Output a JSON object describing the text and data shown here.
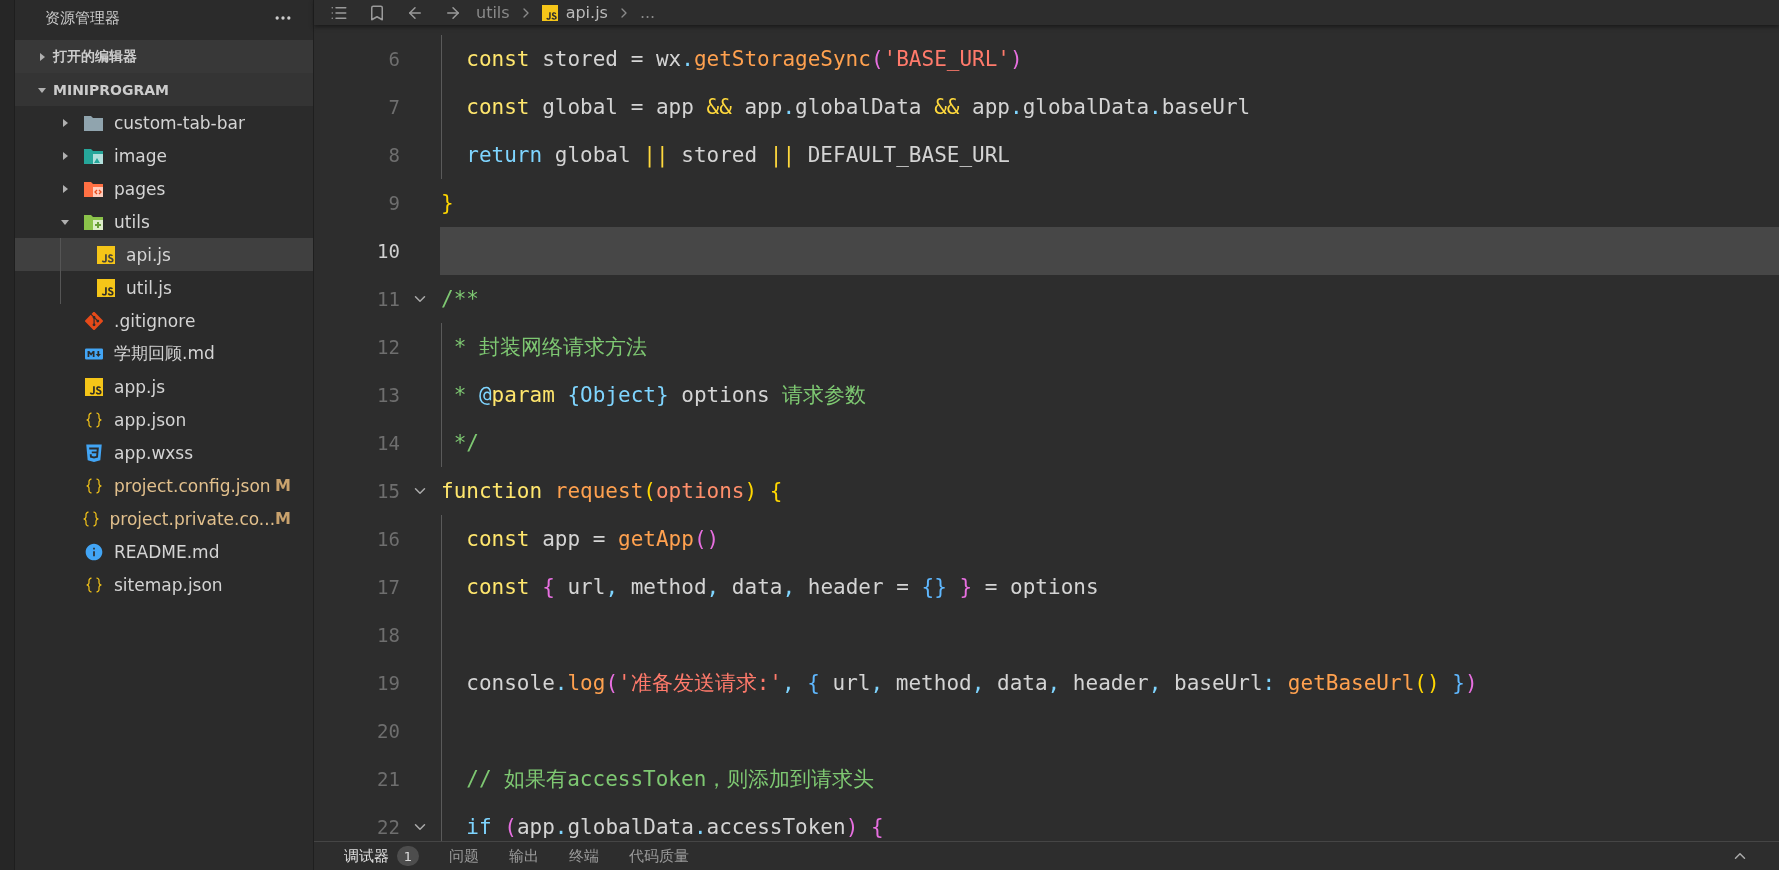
{
  "sidebar": {
    "title": "资源管理器",
    "sections": [
      {
        "label": "打开的编辑器",
        "expanded": false
      },
      {
        "label": "MINIPROGRAM",
        "expanded": true,
        "items": [
          {
            "name": "custom-tab-bar",
            "kind": "folder",
            "expanded": false,
            "selected": false
          },
          {
            "name": "image",
            "kind": "image-folder",
            "expanded": false,
            "selected": false
          },
          {
            "name": "pages",
            "kind": "pages-folder",
            "expanded": false,
            "selected": false
          },
          {
            "name": "utils",
            "kind": "utils-folder",
            "expanded": true,
            "selected": false,
            "children": [
              {
                "name": "api.js",
                "kind": "js",
                "selected": true
              },
              {
                "name": "util.js",
                "kind": "js",
                "selected": false
              }
            ]
          },
          {
            "name": ".gitignore",
            "kind": "git",
            "selected": false
          },
          {
            "name": "学期回顾.md",
            "kind": "markdown",
            "selected": false
          },
          {
            "name": "app.js",
            "kind": "js",
            "selected": false
          },
          {
            "name": "app.json",
            "kind": "json",
            "selected": false
          },
          {
            "name": "app.wxss",
            "kind": "css",
            "selected": false
          },
          {
            "name": "project.config.json",
            "kind": "json",
            "selected": false,
            "status": "M"
          },
          {
            "name": "project.private.co...",
            "kind": "json",
            "selected": false,
            "status": "M"
          },
          {
            "name": "README.md",
            "kind": "info",
            "selected": false
          },
          {
            "name": "sitemap.json",
            "kind": "json",
            "selected": false
          }
        ]
      }
    ]
  },
  "breadcrumb": [
    {
      "label": "utils",
      "kind": "folder"
    },
    {
      "label": "api.js",
      "kind": "js"
    },
    {
      "label": "...",
      "kind": "more"
    }
  ],
  "editor": {
    "lines": [
      {
        "number": "6",
        "guide": true,
        "fold": false,
        "current": false,
        "tokens": [
          {
            "kind": "kw",
            "text": "  const"
          },
          {
            "kind": "plain",
            "text": " stored = wx"
          },
          {
            "kind": "punct",
            "text": "."
          },
          {
            "kind": "fn",
            "text": "getStorageSync"
          },
          {
            "kind": "b2",
            "text": "("
          },
          {
            "kind": "str",
            "text": "'BASE_URL'"
          },
          {
            "kind": "b2",
            "text": ")"
          }
        ]
      },
      {
        "number": "7",
        "guide": true,
        "fold": false,
        "current": false,
        "tokens": [
          {
            "kind": "kw",
            "text": "  const"
          },
          {
            "kind": "plain",
            "text": " global = app "
          },
          {
            "kind": "op",
            "text": "&&"
          },
          {
            "kind": "plain",
            "text": " app"
          },
          {
            "kind": "punct",
            "text": "."
          },
          {
            "kind": "plain",
            "text": "globalData "
          },
          {
            "kind": "op",
            "text": "&&"
          },
          {
            "kind": "plain",
            "text": " app"
          },
          {
            "kind": "punct",
            "text": "."
          },
          {
            "kind": "plain",
            "text": "globalData"
          },
          {
            "kind": "punct",
            "text": "."
          },
          {
            "kind": "plain",
            "text": "baseUrl"
          }
        ]
      },
      {
        "number": "8",
        "guide": true,
        "fold": false,
        "current": false,
        "tokens": [
          {
            "kind": "kw2",
            "text": "  return"
          },
          {
            "kind": "plain",
            "text": " global "
          },
          {
            "kind": "op",
            "text": "||"
          },
          {
            "kind": "plain",
            "text": " stored "
          },
          {
            "kind": "op",
            "text": "||"
          },
          {
            "kind": "plain",
            "text": " DEFAULT_BASE_URL"
          }
        ]
      },
      {
        "number": "9",
        "guide": false,
        "fold": false,
        "current": false,
        "tokens": [
          {
            "kind": "b1",
            "text": "}"
          }
        ]
      },
      {
        "number": "10",
        "guide": false,
        "fold": false,
        "current": true
      },
      {
        "number": "11",
        "guide": false,
        "fold": true,
        "current": false,
        "tokens": [
          {
            "kind": "comment",
            "text": "/**"
          }
        ]
      },
      {
        "number": "12",
        "guide": true,
        "fold": false,
        "current": false,
        "tokens": [
          {
            "kind": "comment",
            "text": " * 封装网络请求方法"
          }
        ]
      },
      {
        "number": "13",
        "guide": true,
        "fold": false,
        "current": false,
        "tokens": [
          {
            "kind": "comment",
            "text": " * "
          },
          {
            "kind": "punct",
            "text": "@"
          },
          {
            "kind": "kw",
            "text": "param"
          },
          {
            "kind": "type",
            "text": " {Object}"
          },
          {
            "kind": "plain",
            "text": " options "
          },
          {
            "kind": "comment",
            "text": "请求参数"
          }
        ]
      },
      {
        "number": "14",
        "guide": true,
        "fold": false,
        "current": false,
        "tokens": [
          {
            "kind": "comment",
            "text": " */"
          }
        ]
      },
      {
        "number": "15",
        "guide": false,
        "fold": true,
        "current": false,
        "tokens": [
          {
            "kind": "kw",
            "text": "function"
          },
          {
            "kind": "fn",
            "text": " request"
          },
          {
            "kind": "b1",
            "text": "("
          },
          {
            "kind": "param",
            "text": "options"
          },
          {
            "kind": "b1",
            "text": ") {"
          }
        ]
      },
      {
        "number": "16",
        "guide": true,
        "fold": false,
        "current": false,
        "tokens": [
          {
            "kind": "kw",
            "text": "  const"
          },
          {
            "kind": "plain",
            "text": " app = "
          },
          {
            "kind": "fn",
            "text": "getApp"
          },
          {
            "kind": "b2",
            "text": "()"
          }
        ]
      },
      {
        "number": "17",
        "guide": true,
        "fold": false,
        "current": false,
        "tokens": [
          {
            "kind": "kw",
            "text": "  const"
          },
          {
            "kind": "b2",
            "text": " {"
          },
          {
            "kind": "plain",
            "text": " url"
          },
          {
            "kind": "punct",
            "text": ","
          },
          {
            "kind": "plain",
            "text": " method"
          },
          {
            "kind": "punct",
            "text": ","
          },
          {
            "kind": "plain",
            "text": " data"
          },
          {
            "kind": "punct",
            "text": ","
          },
          {
            "kind": "plain",
            "text": " header = "
          },
          {
            "kind": "b3",
            "text": "{}"
          },
          {
            "kind": "b2",
            "text": " }"
          },
          {
            "kind": "plain",
            "text": " = options"
          }
        ]
      },
      {
        "number": "18",
        "guide": true,
        "fold": false,
        "current": false
      },
      {
        "number": "19",
        "guide": true,
        "fold": false,
        "current": false,
        "tokens": [
          {
            "kind": "plain",
            "text": "  console"
          },
          {
            "kind": "punct",
            "text": "."
          },
          {
            "kind": "fn",
            "text": "log"
          },
          {
            "kind": "b2",
            "text": "("
          },
          {
            "kind": "str",
            "text": "'准备发送请求:'"
          },
          {
            "kind": "punct",
            "text": ","
          },
          {
            "kind": "b3",
            "text": " {"
          },
          {
            "kind": "plain",
            "text": " url"
          },
          {
            "kind": "punct",
            "text": ","
          },
          {
            "kind": "plain",
            "text": " method"
          },
          {
            "kind": "punct",
            "text": ","
          },
          {
            "kind": "plain",
            "text": " data"
          },
          {
            "kind": "punct",
            "text": ","
          },
          {
            "kind": "plain",
            "text": " header"
          },
          {
            "kind": "punct",
            "text": ","
          },
          {
            "kind": "plain",
            "text": " baseUrl"
          },
          {
            "kind": "punct",
            "text": ":"
          },
          {
            "kind": "fn",
            "text": " getBaseUrl"
          },
          {
            "kind": "b1",
            "text": "()"
          },
          {
            "kind": "b3",
            "text": " }"
          },
          {
            "kind": "b2",
            "text": ")"
          }
        ]
      },
      {
        "number": "20",
        "guide": true,
        "fold": false,
        "current": false
      },
      {
        "number": "21",
        "guide": true,
        "fold": false,
        "current": false,
        "tokens": [
          {
            "kind": "comment",
            "text": "  // 如果有accessToken，则添加到请求头"
          }
        ]
      },
      {
        "number": "22",
        "guide": true,
        "fold": true,
        "current": false,
        "tokens": [
          {
            "kind": "kw2",
            "text": "  if"
          },
          {
            "kind": "b2",
            "text": " ("
          },
          {
            "kind": "plain",
            "text": "app"
          },
          {
            "kind": "punct",
            "text": "."
          },
          {
            "kind": "plain",
            "text": "globalData"
          },
          {
            "kind": "punct",
            "text": "."
          },
          {
            "kind": "plain",
            "text": "accessToken"
          },
          {
            "kind": "b2",
            "text": ") {"
          }
        ]
      }
    ]
  },
  "panel": {
    "tabs": [
      {
        "label": "调试器",
        "badge": "1",
        "selected": true
      },
      {
        "label": "问题",
        "selected": false
      },
      {
        "label": "输出",
        "selected": false
      },
      {
        "label": "终端",
        "selected": false
      },
      {
        "label": "代码质量",
        "selected": false
      }
    ]
  }
}
